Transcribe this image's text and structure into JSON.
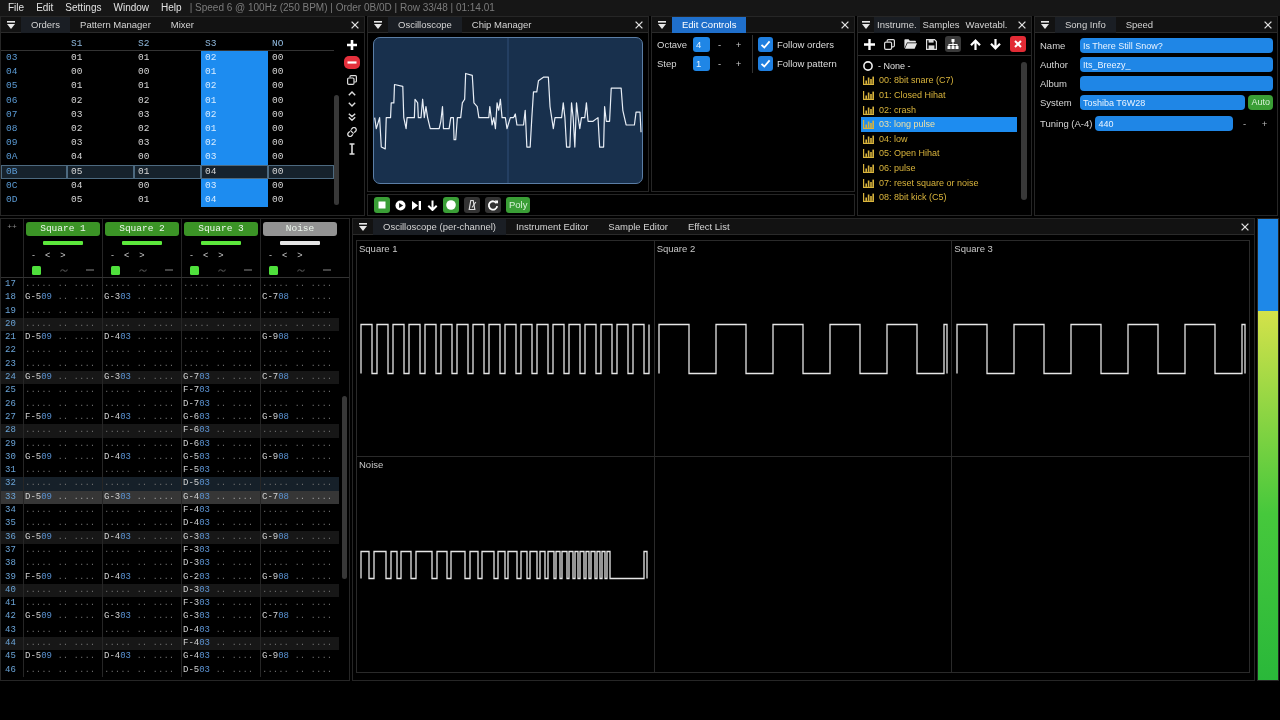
{
  "menu_bar": {
    "menus": [
      "File",
      "Edit",
      "Settings",
      "Window",
      "Help"
    ],
    "status": "| Speed 6 @ 100Hz (250 BPM) | Order 0B/0D | Row 33/48 | 01:14.01"
  },
  "orders_window": {
    "focused": false,
    "tabs": [
      {
        "label": "Orders",
        "selected": true
      },
      {
        "label": "Pattern Manager",
        "selected": false
      },
      {
        "label": "Mixer",
        "selected": false
      }
    ],
    "columns": [
      {
        "label": "S1",
        "selected": false
      },
      {
        "label": "S2",
        "selected": false
      },
      {
        "label": "S3",
        "selected": true
      },
      {
        "label": "NO",
        "selected": false
      }
    ],
    "rows": [
      {
        "label": "03",
        "values": [
          "01",
          "01",
          "02",
          "00"
        ],
        "selected": false
      },
      {
        "label": "04",
        "values": [
          "00",
          "00",
          "01",
          "00"
        ],
        "selected": false
      },
      {
        "label": "05",
        "values": [
          "01",
          "01",
          "02",
          "00"
        ],
        "selected": false
      },
      {
        "label": "06",
        "values": [
          "02",
          "02",
          "01",
          "00"
        ],
        "selected": false
      },
      {
        "label": "07",
        "values": [
          "03",
          "03",
          "02",
          "00"
        ],
        "selected": false
      },
      {
        "label": "08",
        "values": [
          "02",
          "02",
          "01",
          "00"
        ],
        "selected": false
      },
      {
        "label": "09",
        "values": [
          "03",
          "03",
          "02",
          "00"
        ],
        "selected": false
      },
      {
        "label": "0A",
        "values": [
          "04",
          "00",
          "03",
          "00"
        ],
        "selected": false
      },
      {
        "label": "0B",
        "values": [
          "05",
          "01",
          "04",
          "00"
        ],
        "selected": true
      },
      {
        "label": "0C",
        "values": [
          "04",
          "00",
          "03",
          "00"
        ],
        "selected": false
      },
      {
        "label": "0D",
        "values": [
          "05",
          "01",
          "04",
          "00"
        ],
        "selected": false
      }
    ]
  },
  "oscilloscope_window": {
    "focused": false,
    "tabs": [
      {
        "label": "Oscilloscope",
        "selected": true
      },
      {
        "label": "Chip Manager",
        "selected": false
      }
    ]
  },
  "edit_controls_window": {
    "focused": true,
    "tabs": [
      {
        "label": "Edit Controls",
        "selected": true
      }
    ],
    "fields": [
      {
        "label": "Octave",
        "value": "4",
        "buttons": [
          "-",
          "+"
        ]
      },
      {
        "label": "Step",
        "value": "1",
        "buttons": [
          "-",
          "+"
        ]
      }
    ],
    "checkboxes": [
      {
        "label": "Follow orders",
        "checked": true
      },
      {
        "label": "Follow pattern",
        "checked": true
      }
    ]
  },
  "transport": {
    "buttons": [
      {
        "kind": "stop",
        "on": true
      },
      {
        "kind": "play",
        "on": false
      },
      {
        "kind": "step",
        "on": false
      },
      {
        "kind": "down",
        "on": false
      },
      {
        "kind": "record",
        "on": true
      },
      {
        "kind": "metronome",
        "on": false
      },
      {
        "kind": "repeat",
        "on": false
      },
      {
        "kind": "text",
        "label": "Poly",
        "on": true
      }
    ]
  },
  "instruments_window": {
    "focused": false,
    "tabs": [
      {
        "label": "Instrume.",
        "selected": true
      },
      {
        "label": "Samples",
        "selected": false
      },
      {
        "label": "Wavetabl.",
        "selected": false
      }
    ],
    "items": [
      {
        "label": "- None -",
        "kind": "none",
        "selected": false
      },
      {
        "label": "00: 8bit snare (C7)",
        "kind": "instrument",
        "selected": false
      },
      {
        "label": "01: Closed Hihat",
        "kind": "instrument",
        "selected": false
      },
      {
        "label": "02: crash",
        "kind": "instrument",
        "selected": false
      },
      {
        "label": "03: long pulse",
        "kind": "instrument",
        "selected": true
      },
      {
        "label": "04: low",
        "kind": "instrument",
        "selected": false
      },
      {
        "label": "05: Open Hihat",
        "kind": "instrument",
        "selected": false
      },
      {
        "label": "06: pulse",
        "kind": "instrument",
        "selected": false
      },
      {
        "label": "07: reset square or noise",
        "kind": "instrument",
        "selected": false
      },
      {
        "label": "08: 8bit kick (C5)",
        "kind": "instrument",
        "selected": false
      }
    ]
  },
  "song_info_window": {
    "focused": false,
    "tabs": [
      {
        "label": "Song Info",
        "selected": true
      },
      {
        "label": "Speed",
        "selected": false
      }
    ],
    "fields": [
      {
        "label": "Name",
        "value": "Is There Still Snow?"
      },
      {
        "label": "Author",
        "value": "Its_Breezy_"
      },
      {
        "label": "Album"
      },
      {
        "label": "System",
        "value": "Toshiba T6W28",
        "button": "Auto"
      },
      {
        "label": "Tuning (A-4)",
        "value": "440",
        "buttons": [
          "-",
          "+"
        ]
      }
    ]
  },
  "pattern_window": {
    "corner_button": "++",
    "channels": [
      {
        "name": "Square 1",
        "color": "#5ce83c",
        "controls": [
          "-",
          "<",
          ">"
        ]
      },
      {
        "name": "Square 2",
        "color": "#5ce83c",
        "controls": [
          "-",
          "<",
          ">"
        ]
      },
      {
        "name": "Square 3",
        "color": "#5ce83c",
        "controls": [
          "-",
          "<",
          ">"
        ]
      },
      {
        "name": "Noise",
        "color": "#e6e6e6",
        "controls": [
          "-",
          "<",
          ">"
        ]
      }
    ],
    "rows": [
      {
        "number": "17",
        "kind": "plain",
        "cells": [
          "..... .. ....",
          "..... .. ....",
          "..... .. ....",
          "..... .. ...."
        ]
      },
      {
        "number": "18",
        "kind": "plain",
        "cells": [
          "G-509 .. ....",
          "G-303 .. ....",
          "..... .. ....",
          "C-708 .. ...."
        ]
      },
      {
        "number": "19",
        "kind": "plain",
        "cells": [
          "..... .. ....",
          "..... .. ....",
          "..... .. ....",
          "..... .. ...."
        ]
      },
      {
        "number": "20",
        "kind": "beat",
        "cells": [
          "..... .. ....",
          "..... .. ....",
          "..... .. ....",
          "..... .. ...."
        ]
      },
      {
        "number": "21",
        "kind": "plain",
        "cells": [
          "D-509 .. ....",
          "D-403 .. ....",
          "..... .. ....",
          "G-908 .. ...."
        ]
      },
      {
        "number": "22",
        "kind": "plain",
        "cells": [
          "..... .. ....",
          "..... .. ....",
          "..... .. ....",
          "..... .. ...."
        ]
      },
      {
        "number": "23",
        "kind": "plain",
        "cells": [
          "..... .. ....",
          "..... .. ....",
          "..... .. ....",
          "..... .. ...."
        ]
      },
      {
        "number": "24",
        "kind": "beat",
        "cells": [
          "G-509 .. ....",
          "G-303 .. ....",
          "G-703 .. ....",
          "C-708 .. ...."
        ]
      },
      {
        "number": "25",
        "kind": "plain",
        "cells": [
          "..... .. ....",
          "..... .. ....",
          "F-703 .. ....",
          "..... .. ...."
        ]
      },
      {
        "number": "26",
        "kind": "plain",
        "cells": [
          "..... .. ....",
          "..... .. ....",
          "D-703 .. ....",
          "..... .. ...."
        ]
      },
      {
        "number": "27",
        "kind": "plain",
        "cells": [
          "F-509 .. ....",
          "D-403 .. ....",
          "G-603 .. ....",
          "G-908 .. ...."
        ]
      },
      {
        "number": "28",
        "kind": "beat",
        "cells": [
          "..... .. ....",
          "..... .. ....",
          "F-603 .. ....",
          "..... .. ...."
        ]
      },
      {
        "number": "29",
        "kind": "plain",
        "cells": [
          "..... .. ....",
          "..... .. ....",
          "D-603 .. ....",
          "..... .. ...."
        ]
      },
      {
        "number": "30",
        "kind": "plain",
        "cells": [
          "G-509 .. ....",
          "D-403 .. ....",
          "G-503 .. ....",
          "G-908 .. ...."
        ]
      },
      {
        "number": "31",
        "kind": "plain",
        "cells": [
          "..... .. ....",
          "..... .. ....",
          "F-503 .. ....",
          "..... .. ...."
        ]
      },
      {
        "number": "32",
        "kind": "cursor",
        "cells": [
          "..... .. ....",
          "..... .. ....",
          "D-503 .. ....",
          "..... .. ...."
        ]
      },
      {
        "number": "33",
        "kind": "playing",
        "cells": [
          "D-509 .. ....",
          "G-303 .. ....",
          "G-403 .. ....",
          "C-708 .. ...."
        ]
      },
      {
        "number": "34",
        "kind": "plain",
        "cells": [
          "..... .. ....",
          "..... .. ....",
          "F-403 .. ....",
          "..... .. ...."
        ]
      },
      {
        "number": "35",
        "kind": "plain",
        "cells": [
          "..... .. ....",
          "..... .. ....",
          "D-403 .. ....",
          "..... .. ...."
        ]
      },
      {
        "number": "36",
        "kind": "beat",
        "cells": [
          "G-509 .. ....",
          "D-403 .. ....",
          "G-303 .. ....",
          "G-908 .. ...."
        ]
      },
      {
        "number": "37",
        "kind": "plain",
        "cells": [
          "..... .. ....",
          "..... .. ....",
          "F-303 .. ....",
          "..... .. ...."
        ]
      },
      {
        "number": "38",
        "kind": "plain",
        "cells": [
          "..... .. ....",
          "..... .. ....",
          "D-303 .. ....",
          "..... .. ...."
        ]
      },
      {
        "number": "39",
        "kind": "plain",
        "cells": [
          "F-509 .. ....",
          "D-403 .. ....",
          "G-203 .. ....",
          "G-908 .. ...."
        ]
      },
      {
        "number": "40",
        "kind": "beat",
        "cells": [
          "..... .. ....",
          "..... .. ....",
          "D-303 .. ....",
          "..... .. ...."
        ]
      },
      {
        "number": "41",
        "kind": "plain",
        "cells": [
          "..... .. ....",
          "..... .. ....",
          "F-303 .. ....",
          "..... .. ...."
        ]
      },
      {
        "number": "42",
        "kind": "plain",
        "cells": [
          "G-509 .. ....",
          "G-303 .. ....",
          "G-303 .. ....",
          "C-708 .. ...."
        ]
      },
      {
        "number": "43",
        "kind": "plain",
        "cells": [
          "..... .. ....",
          "..... .. ....",
          "D-403 .. ....",
          "..... .. ...."
        ]
      },
      {
        "number": "44",
        "kind": "beat",
        "cells": [
          "..... .. ....",
          "..... .. ....",
          "F-403 .. ....",
          "..... .. ...."
        ]
      },
      {
        "number": "45",
        "kind": "plain",
        "cells": [
          "D-509 .. ....",
          "D-403 .. ....",
          "G-403 .. ....",
          "G-908 .. ...."
        ]
      },
      {
        "number": "46",
        "kind": "plain",
        "cells": [
          "..... .. ....",
          "..... .. ....",
          "D-503 .. ....",
          "..... .. ...."
        ]
      }
    ]
  },
  "channel_oscilloscope_window": {
    "focused": false,
    "tabs": [
      {
        "label": "Oscilloscope (per-channel)",
        "selected": true
      },
      {
        "label": "Instrument Editor",
        "selected": false
      },
      {
        "label": "Sample Editor",
        "selected": false
      },
      {
        "label": "Effect List",
        "selected": false
      }
    ],
    "panes": [
      {
        "label": "Square 1",
        "kind": "pulse"
      },
      {
        "label": "Square 2",
        "kind": "square"
      },
      {
        "label": "Square 3",
        "kind": "square"
      },
      {
        "label": "Noise",
        "kind": "noise"
      }
    ]
  },
  "volume_meter": {
    "level": 0.8
  }
}
